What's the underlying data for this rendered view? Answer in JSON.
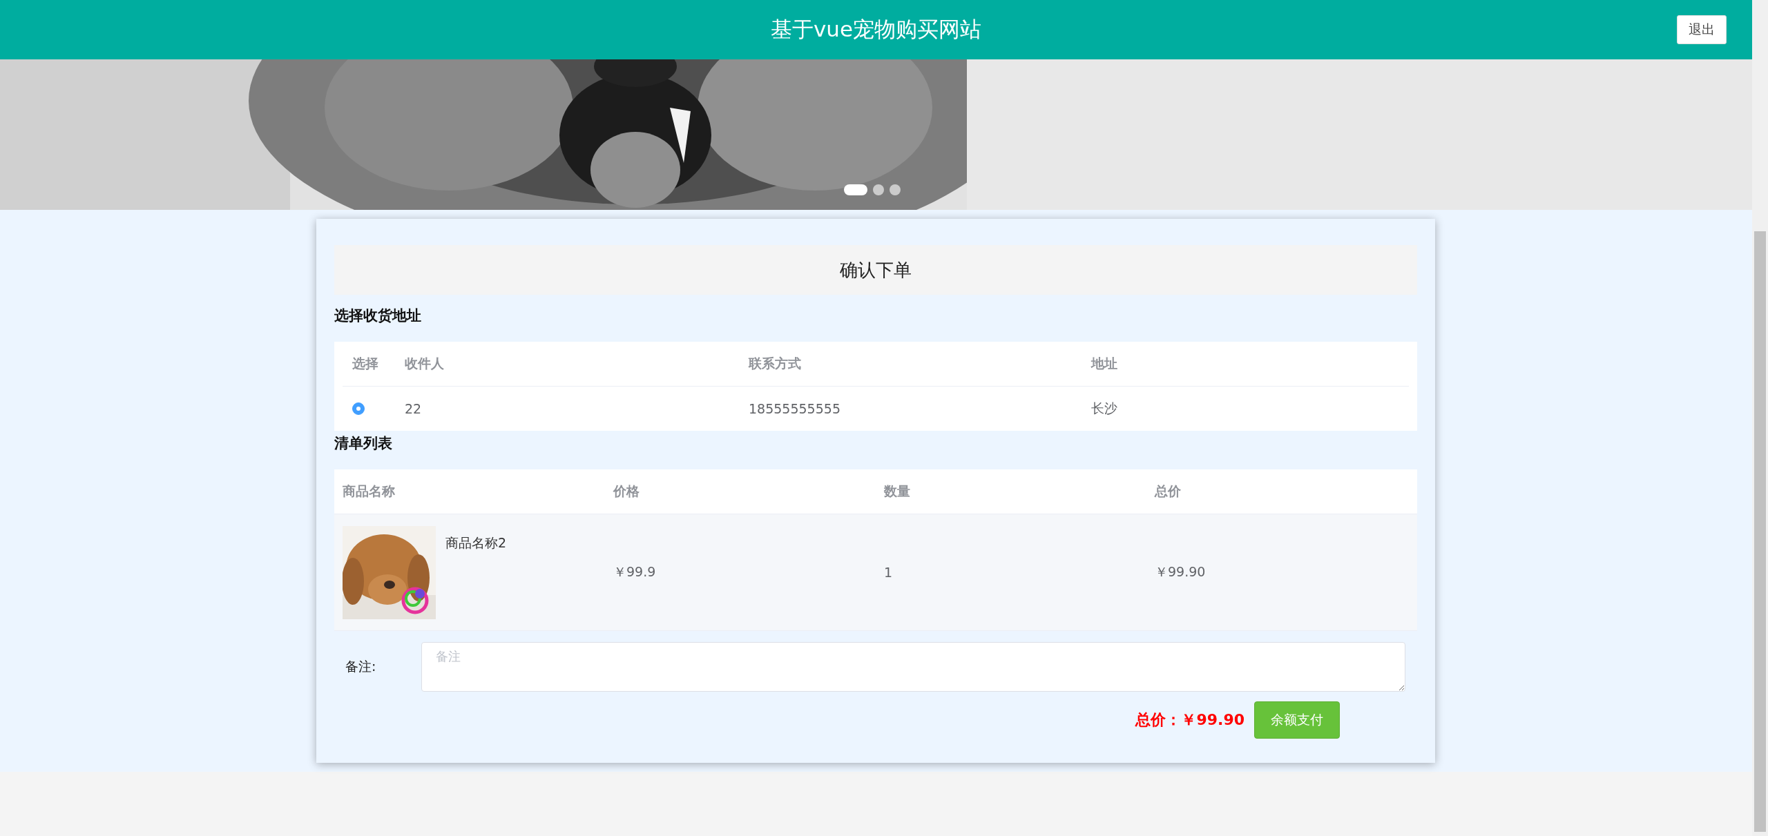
{
  "header": {
    "title": "基于vue宠物购买网站",
    "logout": "退出"
  },
  "banner": {
    "kind": "picture",
    "slides": [
      {
        "selected": true
      },
      {
        "selected": false
      },
      {
        "selected": false
      }
    ]
  },
  "order": {
    "title": "确认下单",
    "address_section": {
      "title": "选择收货地址",
      "columns": [
        "选择",
        "收件人",
        "联系方式",
        "地址"
      ],
      "rows": [
        {
          "selected": true,
          "name": "22",
          "phone": "18555555555",
          "address": "长沙"
        }
      ]
    },
    "items_section": {
      "title": "清单列表",
      "columns": [
        "商品名称",
        "价格",
        "数量",
        "总价"
      ],
      "rows": [
        {
          "name": "商品名称2",
          "price": "￥99.9",
          "quantity": "1",
          "total": "￥99.90"
        }
      ]
    },
    "remark": {
      "label": "备注:",
      "placeholder": "备注"
    },
    "total": "总价：￥99.90",
    "pay_button": "余额支付"
  }
}
